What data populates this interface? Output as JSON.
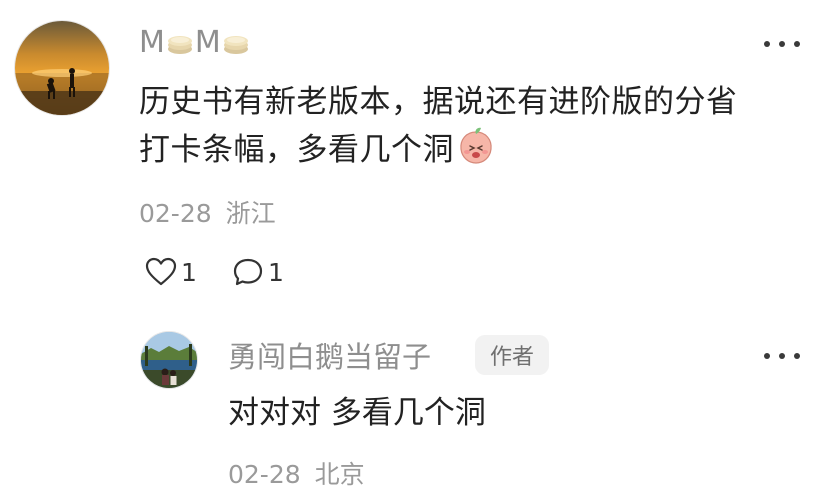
{
  "comment": {
    "username": "M M",
    "username_parts": [
      "M",
      "M"
    ],
    "text_line1": "历史书有新老版本，据说还有进阶版的分省",
    "text_line2": "打卡条幅，多看几个洞",
    "date": "02-28",
    "location": "浙江",
    "like_count": "1",
    "reply_count": "1",
    "emoji": "peach-face-emoji"
  },
  "reply": {
    "username": "勇闯白鹅当留子",
    "badge": "作者",
    "text": "对对对 多看几个洞",
    "date": "02-28",
    "location": "北京"
  },
  "icons": {
    "more": "more-dots-icon",
    "like": "heart-outline-icon",
    "comment": "comment-bubble-icon",
    "coin": "coin-stack-icon"
  },
  "colors": {
    "text_primary": "#222222",
    "text_secondary": "#8e8e8e",
    "meta": "#9a9a9a",
    "badge_bg": "#f2f2f2"
  }
}
